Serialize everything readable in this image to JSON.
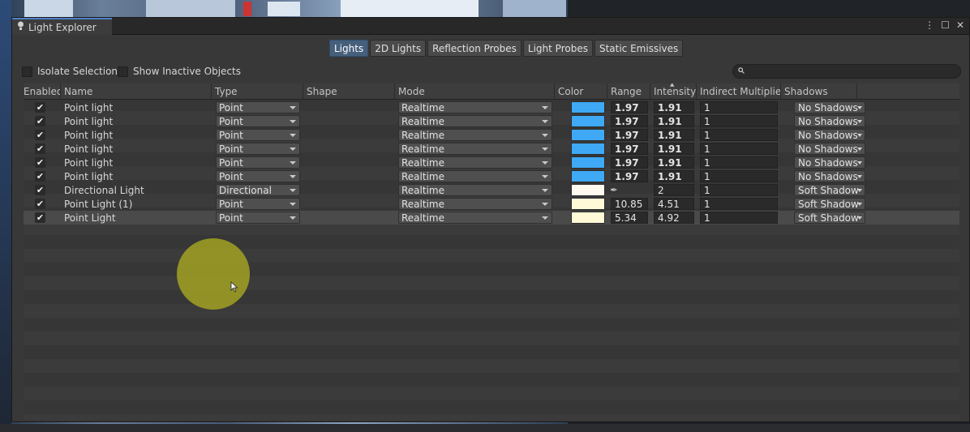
{
  "window": {
    "title": "Light Explorer",
    "controls": {
      "menu": "⋮",
      "maximize": "☐",
      "close": "✕"
    }
  },
  "categories": [
    {
      "label": "Lights",
      "active": true
    },
    {
      "label": "2D Lights",
      "active": false
    },
    {
      "label": "Reflection Probes",
      "active": false
    },
    {
      "label": "Light Probes",
      "active": false
    },
    {
      "label": "Static Emissives",
      "active": false
    }
  ],
  "toolbar": {
    "isolate_selection": "Isolate Selection",
    "show_inactive": "Show Inactive Objects",
    "search_placeholder": ""
  },
  "columns": {
    "enabled": "Enabled",
    "name": "Name",
    "type": "Type",
    "shape": "Shape",
    "mode": "Mode",
    "color": "Color",
    "range": "Range",
    "intensity": "Intensity",
    "indirect": "Indirect Multiplier",
    "shadows": "Shadows"
  },
  "rows": [
    {
      "enabled": "✔",
      "name": "Point light",
      "type": "Point",
      "mode": "Realtime",
      "color": "#3fa9f5",
      "range": "1.97",
      "intensity": "1.91",
      "indirect": "1",
      "shadows": "No Shadows"
    },
    {
      "enabled": "✔",
      "name": "Point light",
      "type": "Point",
      "mode": "Realtime",
      "color": "#3fa9f5",
      "range": "1.97",
      "intensity": "1.91",
      "indirect": "1",
      "shadows": "No Shadows"
    },
    {
      "enabled": "✔",
      "name": "Point light",
      "type": "Point",
      "mode": "Realtime",
      "color": "#3fa9f5",
      "range": "1.97",
      "intensity": "1.91",
      "indirect": "1",
      "shadows": "No Shadows"
    },
    {
      "enabled": "✔",
      "name": "Point light",
      "type": "Point",
      "mode": "Realtime",
      "color": "#3fa9f5",
      "range": "1.97",
      "intensity": "1.91",
      "indirect": "1",
      "shadows": "No Shadows"
    },
    {
      "enabled": "✔",
      "name": "Point light",
      "type": "Point",
      "mode": "Realtime",
      "color": "#3fa9f5",
      "range": "1.97",
      "intensity": "1.91",
      "indirect": "1",
      "shadows": "No Shadows"
    },
    {
      "enabled": "✔",
      "name": "Point light",
      "type": "Point",
      "mode": "Realtime",
      "color": "#3fa9f5",
      "range": "1.97",
      "intensity": "1.91",
      "indirect": "1",
      "shadows": "No Shadows"
    },
    {
      "enabled": "✔",
      "name": "Directional Light",
      "type": "Directional",
      "mode": "Realtime",
      "color": "#fffaf0",
      "range": "",
      "intensity": "2",
      "indirect": "1",
      "shadows": "Soft Shadow"
    },
    {
      "enabled": "✔",
      "name": "Point Light (1)",
      "type": "Point",
      "mode": "Realtime",
      "color": "#fff9d8",
      "range": "10.85",
      "intensity": "4.51",
      "indirect": "1",
      "shadows": "Soft Shadow"
    },
    {
      "enabled": "✔",
      "name": "Point Light",
      "type": "Point",
      "mode": "Realtime",
      "color": "#fff9d8",
      "range": "5.34",
      "intensity": "4.92",
      "indirect": "1",
      "shadows": "Soft Shadow",
      "selected": true
    }
  ]
}
